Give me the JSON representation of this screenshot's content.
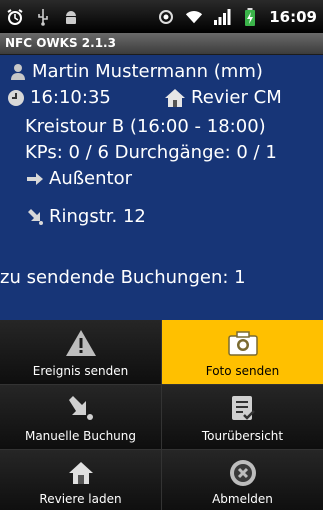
{
  "statusbar": {
    "time": "16:09",
    "icons": [
      "alarm-icon",
      "usb-icon",
      "android-debug-icon",
      "gps-icon",
      "wifi-icon",
      "signal-icon",
      "battery-charging-icon"
    ]
  },
  "app": {
    "title": "NFC OWKS 2.1.3"
  },
  "main": {
    "user": "Martin Mustermann (mm)",
    "clock": "16:10:35",
    "revier": "Revier CM",
    "tour": "Kreistour B (16:00 - 18:00)",
    "kps": "KPs: 0 / 6 Durchgänge: 0 / 1",
    "next_location": "Außentor",
    "address": "Ringstr. 12",
    "pending": "zu sendende Buchungen: 1"
  },
  "buttons": {
    "event": "Ereignis senden",
    "photo": "Foto senden",
    "manual": "Manuelle Buchung",
    "tour": "Tourübersicht",
    "load": "Reviere laden",
    "logout": "Abmelden"
  },
  "colors": {
    "panel": "#173577",
    "highlight": "#ffc000",
    "button": "#1a1a1a"
  }
}
